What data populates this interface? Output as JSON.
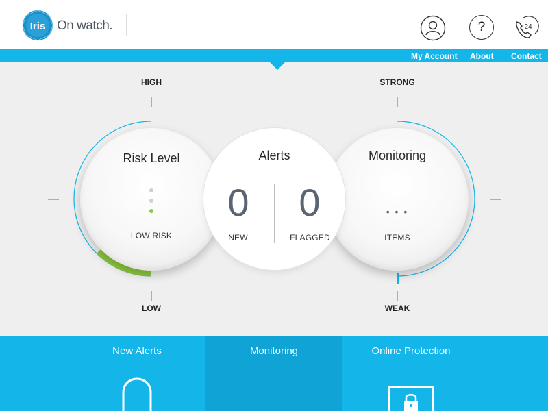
{
  "brand": {
    "logo_text": "Iris",
    "tagline": "On watch."
  },
  "header_icons": {
    "account": "user-icon",
    "help": "?",
    "contact_badge": "24"
  },
  "nav": {
    "links": [
      {
        "label": "My Account"
      },
      {
        "label": "About"
      },
      {
        "label": "Contact"
      }
    ]
  },
  "risk": {
    "title": "Risk Level",
    "status": "LOW RISK",
    "scale_high": "HIGH",
    "scale_low": "LOW",
    "level_fraction": 0.25,
    "level_color": "#8dc63f"
  },
  "alerts": {
    "title": "Alerts",
    "new_count": "0",
    "new_label": "NEW",
    "flagged_count": "0",
    "flagged_label": "FLAGGED"
  },
  "monitoring": {
    "title": "Monitoring",
    "items_value": "• • •",
    "items_label": "ITEMS",
    "scale_strong": "STRONG",
    "scale_weak": "WEAK"
  },
  "bottom_tabs": [
    {
      "label": "New Alerts",
      "icon": "bell-icon"
    },
    {
      "label": "Monitoring",
      "icon": ""
    },
    {
      "label": "Online Protection",
      "icon": "lock-icon"
    }
  ],
  "colors": {
    "accent": "#14b5e8",
    "tab_active": "#0fa3d6",
    "risk_green": "#8dc63f"
  }
}
